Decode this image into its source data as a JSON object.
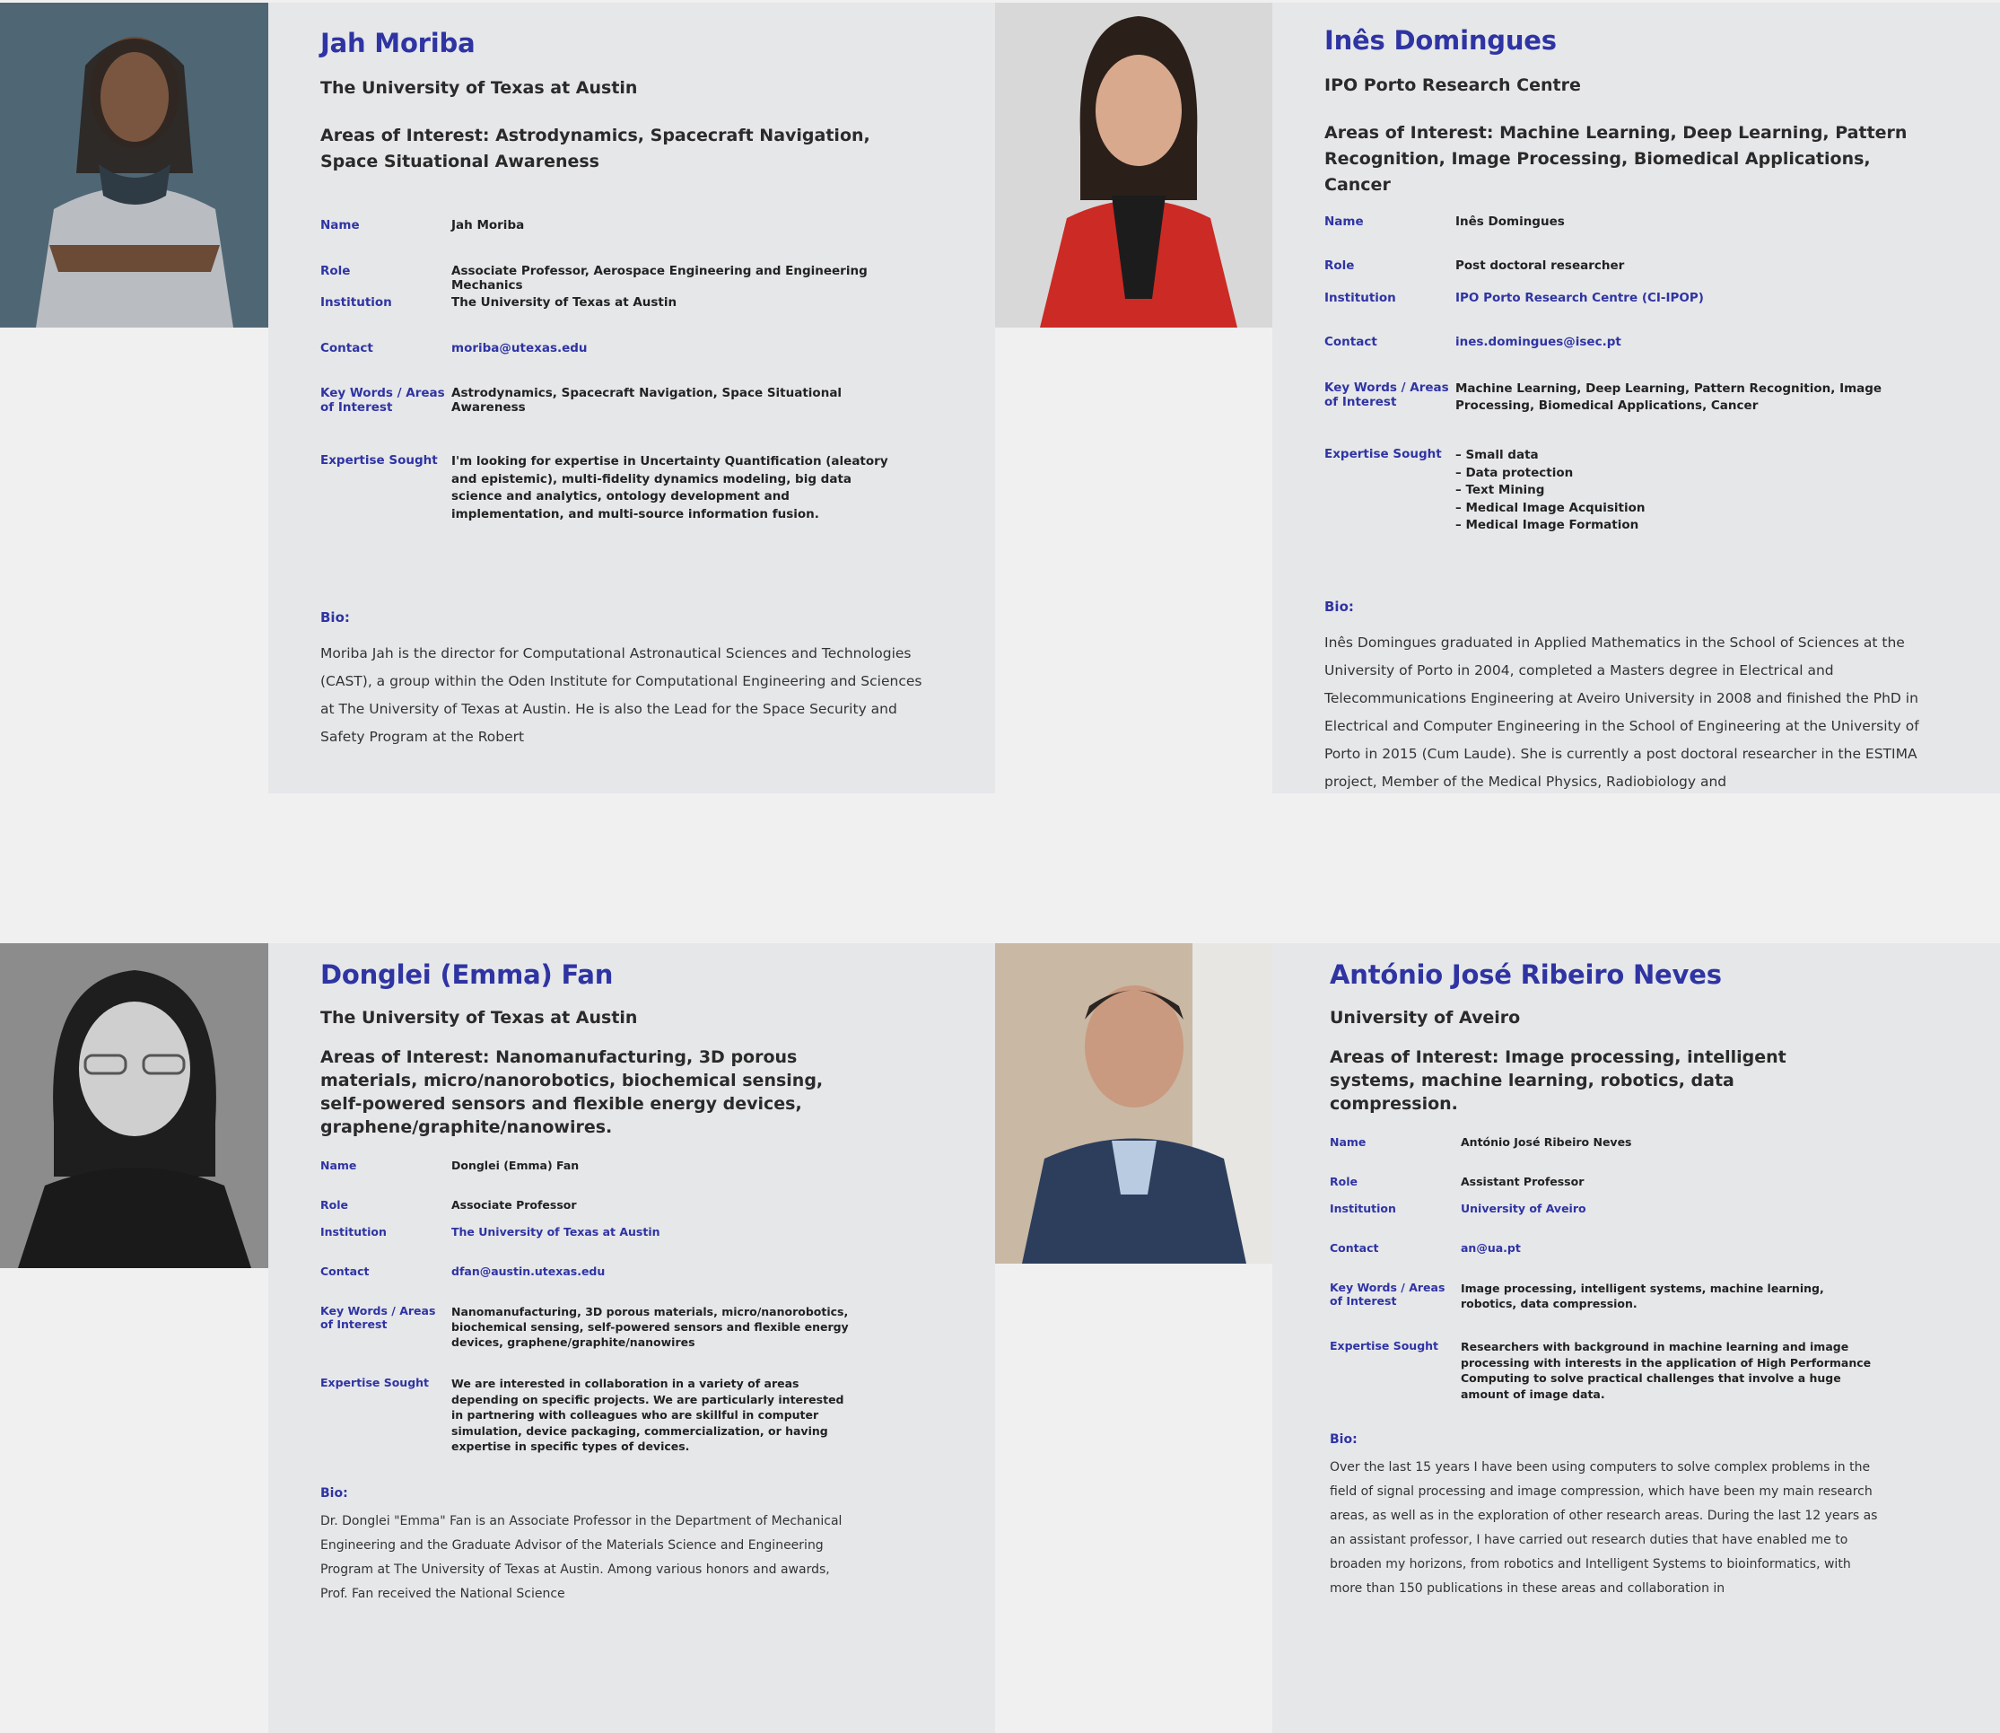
{
  "cards": [
    {
      "name": "Jah Moriba",
      "institution": "The University of Texas at Austin",
      "areas": "Areas of Interest: Astrodynamics, Spacecraft Navigation, Space Situational Awareness",
      "labels": {
        "name": "Name",
        "role": "Role",
        "institution": "Institution",
        "contact": "Contact",
        "keywords": "Key Words / Areas of Interest",
        "expertise": "Expertise Sought"
      },
      "values": {
        "name": "Jah Moriba",
        "role": "Associate Professor, Aerospace Engineering and Engineering Mechanics",
        "institution": "The University of Texas at Austin",
        "contact": "moriba@utexas.edu",
        "keywords": "Astrodynamics, Spacecraft Navigation, Space Situational Awareness",
        "expertise": "I'm looking for expertise in Uncertainty Quantification (aleatory and epistemic), multi-fidelity dynamics modeling, big data science and analytics, ontology development and implementation, and multi-source information fusion."
      },
      "bio_heading": "Bio:",
      "bio": "Moriba Jah is the director for Computational Astronautical Sciences and Technologies (CAST), a group within the Oden Institute for Computational Engineering and Sciences at The University of Texas at Austin. He is also the Lead for the Space Security and Safety Program at the Robert"
    },
    {
      "name": "Inês Domingues",
      "institution": "IPO Porto Research Centre",
      "areas": "Areas of Interest: Machine Learning, Deep Learning, Pattern Recognition, Image Processing, Biomedical Applications, Cancer",
      "labels": {
        "name": "Name",
        "role": "Role",
        "institution": "Institution",
        "contact": "Contact",
        "keywords": "Key Words / Areas of Interest",
        "expertise": "Expertise Sought"
      },
      "values": {
        "name": "Inês Domingues",
        "role": "Post doctoral researcher",
        "institution": "IPO Porto Research Centre (CI-IPOP)",
        "contact": "ines.domingues@isec.pt",
        "keywords": "Machine Learning, Deep Learning, Pattern Recognition, Image Processing, Biomedical Applications, Cancer",
        "expertise_list": [
          "– Small data",
          "– Data protection",
          "– Text Mining",
          "– Medical Image Acquisition",
          "– Medical Image Formation"
        ]
      },
      "bio_heading": "Bio:",
      "bio": "Inês Domingues graduated in Applied Mathematics in the School of Sciences at the University of Porto in 2004, completed a Masters degree in Electrical and Telecommunications Engineering at Aveiro University in 2008 and finished the PhD in Electrical and Computer Engineering in the School of Engineering at the University of Porto in 2015 (Cum Laude). She is currently a post doctoral researcher in the ESTIMA project, Member of the Medical Physics, Radiobiology and"
    },
    {
      "name": "Donglei (Emma) Fan",
      "institution": "The University of Texas at Austin",
      "areas": "Areas of Interest: Nanomanufacturing, 3D porous materials, micro/nanorobotics, biochemical sensing, self-powered sensors and flexible energy devices, graphene/graphite/nanowires.",
      "labels": {
        "name": "Name",
        "role": "Role",
        "institution": "Institution",
        "contact": "Contact",
        "keywords": "Key Words / Areas of Interest",
        "expertise": "Expertise Sought"
      },
      "values": {
        "name": "Donglei (Emma) Fan",
        "role": "Associate Professor",
        "institution": "The University of Texas at Austin",
        "contact": "dfan@austin.utexas.edu",
        "keywords": "Nanomanufacturing, 3D porous materials, micro/nanorobotics, biochemical sensing, self-powered sensors and flexible energy devices, graphene/graphite/nanowires",
        "expertise": "We are interested in collaboration in a variety of areas depending on specific projects. We are particularly interested in partnering with colleagues who are skillful in computer simulation, device packaging, commercialization, or having expertise in specific types of devices."
      },
      "bio_heading": "Bio:",
      "bio": "Dr. Donglei \"Emma\" Fan is an Associate Professor in the Department of Mechanical Engineering and the Graduate Advisor of the Materials Science and Engineering Program at The University of Texas at Austin. Among various honors and awards, Prof. Fan received the National Science"
    },
    {
      "name": "António José Ribeiro Neves",
      "institution": "University of Aveiro",
      "areas": "Areas of Interest: Image processing, intelligent systems, machine learning, robotics, data compression.",
      "labels": {
        "name": "Name",
        "role": "Role",
        "institution": "Institution",
        "contact": "Contact",
        "keywords": "Key Words / Areas of Interest",
        "expertise": "Expertise Sought"
      },
      "values": {
        "name": "António José Ribeiro Neves",
        "role": "Assistant Professor",
        "institution": "University of Aveiro",
        "contact": "an@ua.pt",
        "keywords": "Image processing, intelligent systems, machine learning, robotics, data compression.",
        "expertise": "Researchers with background in machine learning and image processing with interests in the application of High Performance Computing to solve practical challenges that involve a huge amount of image data."
      },
      "bio_heading": "Bio:",
      "bio": "Over the last 15 years I have been using computers to solve complex problems in the field of signal processing and image compression, which have been my main research areas, as well as in the exploration of other research areas. During the last 12 years as an assistant professor, I have carried out research duties that have enabled me to broaden my horizons, from robotics and Intelligent Systems to bioinformatics, with more than 150 publications in these areas and collaboration in"
    }
  ]
}
